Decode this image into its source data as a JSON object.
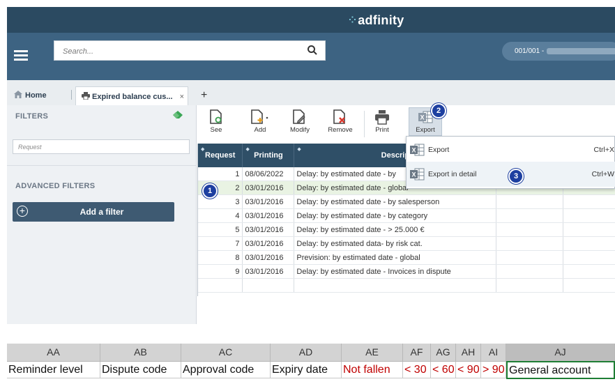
{
  "app": {
    "brand": "adfinity",
    "search": {
      "placeholder": "Search..."
    },
    "company": "001/001 -"
  },
  "tabs": {
    "home": "Home",
    "active": "Expired balance cus...",
    "close": "×",
    "add": "+"
  },
  "filters": {
    "title": "FILTERS",
    "request_placeholder": "Request",
    "advanced_title": "ADVANCED FILTERS",
    "add_filter": "Add a filter"
  },
  "toolbar": {
    "see": "See",
    "add": "Add",
    "modify": "Modify",
    "remove": "Remove",
    "print": "Print",
    "export": "Export"
  },
  "grid": {
    "columns": [
      "Request",
      "Printing",
      "Descrip"
    ],
    "rows": [
      {
        "request": "1",
        "printing": "08/06/2022",
        "description": "Delay: by estimated date - by"
      },
      {
        "request": "2",
        "printing": "03/01/2016",
        "description": "Delay: by estimated date - global"
      },
      {
        "request": "3",
        "printing": "03/01/2016",
        "description": "Delay: by estimated date - by salesperson"
      },
      {
        "request": "4",
        "printing": "03/01/2016",
        "description": "Delay: by estimated date - by category"
      },
      {
        "request": "5",
        "printing": "03/01/2016",
        "description": "Delay: by estimated date -   > 25.000 €"
      },
      {
        "request": "7",
        "printing": "03/01/2016",
        "description": "Delay: by estimated data- by risk cat."
      },
      {
        "request": "8",
        "printing": "03/01/2016",
        "description": "Prevision: by estimated date - global"
      },
      {
        "request": "9",
        "printing": "03/01/2016",
        "description": "Delay: by estimated date - Invoices in dispute"
      }
    ]
  },
  "export_menu": {
    "items": [
      {
        "label": "Export",
        "shortcut": "Ctrl+X"
      },
      {
        "label": "Export in detail",
        "shortcut": "Ctrl+W"
      }
    ]
  },
  "badges": {
    "one": "1",
    "two": "2",
    "three": "3"
  },
  "sheet": {
    "columns": [
      "AA",
      "AB",
      "AC",
      "AD",
      "AE",
      "AF",
      "AG",
      "AH",
      "AI",
      "AJ"
    ],
    "row": [
      "Reminder level",
      "Dispute code",
      "Approval code",
      "Expiry date",
      "Not fallen",
      "< 30",
      "< 60",
      "< 90",
      "> 90",
      "General account"
    ]
  },
  "colors": {
    "brand_bar": "#2b4a61",
    "search_bar": "#3d6382",
    "grid_header": "#2f4f67",
    "badge": "#1d3fa0",
    "sheet_red": "#c00000",
    "selected_row": "#e9f3e3"
  }
}
